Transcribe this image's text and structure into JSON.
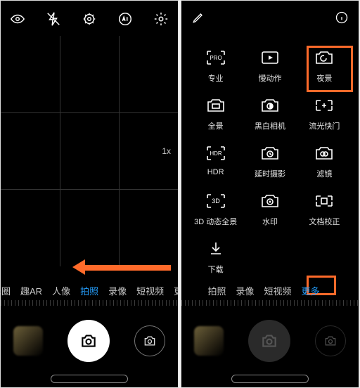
{
  "left": {
    "topbar_icons": [
      "eye-icon",
      "flash-off-icon",
      "settings-gear-icon",
      "ai-icon",
      "settings-icon"
    ],
    "zoom": "1x",
    "modes": [
      {
        "label": "光圈",
        "key": "aperture",
        "partial": "left"
      },
      {
        "label": "趣AR",
        "key": "ar"
      },
      {
        "label": "人像",
        "key": "portrait"
      },
      {
        "label": "拍照",
        "key": "photo",
        "active": true
      },
      {
        "label": "录像",
        "key": "video"
      },
      {
        "label": "短视频",
        "key": "short"
      },
      {
        "label": "更",
        "key": "more",
        "partial": "right"
      }
    ],
    "annotation": "arrow-to-photo-mode"
  },
  "right": {
    "top_left_icon": "edit-icon",
    "top_right_icon": "info-icon",
    "grid": [
      {
        "name": "pro-icon",
        "label": "专业",
        "badge": "PRO"
      },
      {
        "name": "slowmo-icon",
        "label": "慢动作"
      },
      {
        "name": "night-icon",
        "label": "夜景",
        "highlighted": true
      },
      {
        "name": "panorama-icon",
        "label": "全景"
      },
      {
        "name": "mono-icon",
        "label": "黑白相机"
      },
      {
        "name": "lightpaint-icon",
        "label": "流光快门"
      },
      {
        "name": "hdr-icon",
        "label": "HDR",
        "badge": "HDR"
      },
      {
        "name": "timelapse-icon",
        "label": "延时摄影"
      },
      {
        "name": "filter-icon",
        "label": "滤镜"
      },
      {
        "name": "3dpano-icon",
        "label": "3D 动态全景",
        "badge": "3D"
      },
      {
        "name": "watermark-icon",
        "label": "水印"
      },
      {
        "name": "docscan-icon",
        "label": "文档校正"
      },
      {
        "name": "download-icon",
        "label": "下载"
      }
    ],
    "modes": [
      {
        "label": "拍照",
        "key": "photo",
        "partial": "left"
      },
      {
        "label": "录像",
        "key": "video"
      },
      {
        "label": "短视频",
        "key": "short"
      },
      {
        "label": "更多",
        "key": "more",
        "active": true,
        "highlighted": true
      }
    ]
  }
}
